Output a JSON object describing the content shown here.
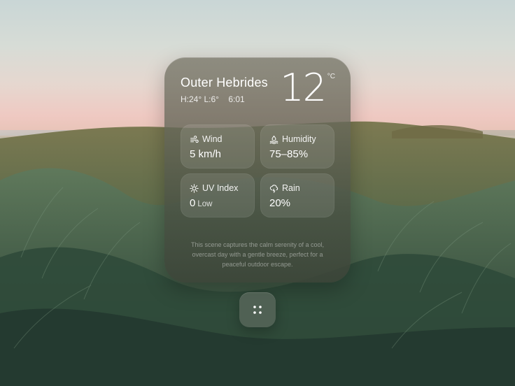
{
  "weather": {
    "location": "Outer Hebrides",
    "high": "H:24°",
    "low": "L:6°",
    "time": "6:01",
    "temperature": "12",
    "unit": "°C",
    "tiles": [
      {
        "label": "Wind",
        "value": "5 km/h",
        "sub": "",
        "icon": "wind-icon"
      },
      {
        "label": "Humidity",
        "value": "75–85%",
        "sub": "",
        "icon": "humidity-icon"
      },
      {
        "label": "UV Index",
        "value": "0",
        "sub": "Low",
        "icon": "sun-icon"
      },
      {
        "label": "Rain",
        "value": "20%",
        "sub": "",
        "icon": "rain-cloud-icon"
      }
    ],
    "description": "This scene captures the calm serenity of a cool, overcast day with a gentle breeze, perfect for a peaceful outdoor escape."
  },
  "dock": {
    "icon": "grid-icon"
  }
}
